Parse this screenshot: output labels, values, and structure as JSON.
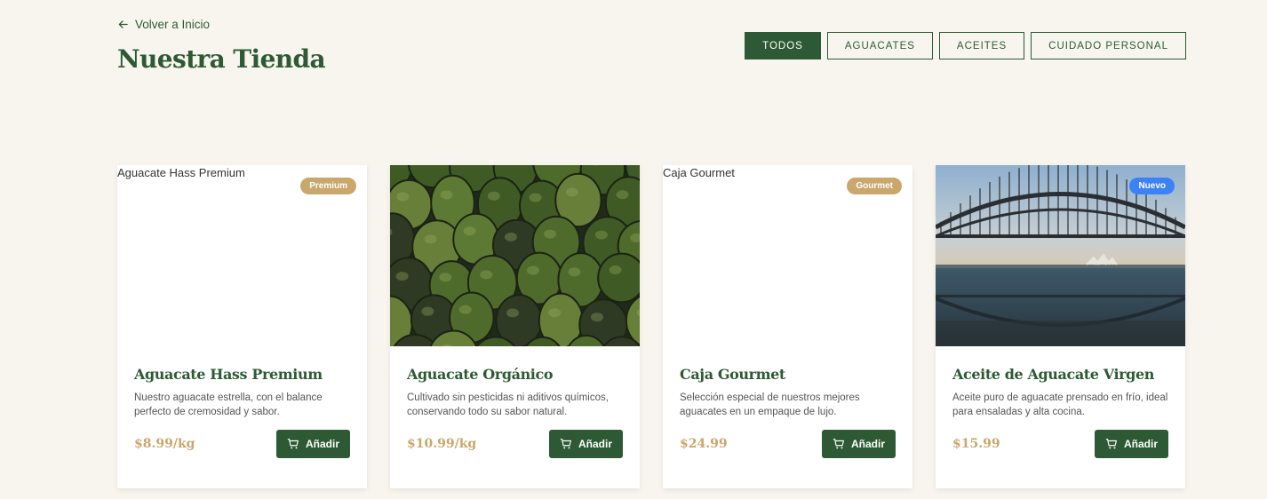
{
  "header": {
    "back_label": "Volver a Inicio",
    "title": "Nuestra Tienda"
  },
  "filters": [
    {
      "label": "TODOS",
      "active": true
    },
    {
      "label": "AGUACATES",
      "active": false
    },
    {
      "label": "ACEITES",
      "active": false
    },
    {
      "label": "CUIDADO PERSONAL",
      "active": false
    }
  ],
  "colors": {
    "primary": "#2d5a34",
    "accent_gold": "#c9a76d",
    "badge_blue": "#3b82f6",
    "background": "#f8f5ee"
  },
  "products": [
    {
      "name": "Aguacate Hass Premium",
      "image_alt": "Aguacate Hass Premium",
      "image": "broken",
      "badge": "Premium",
      "badge_color": "#c9a76d",
      "description": "Nuestro aguacate estrella, con el balance perfecto de cremosidad y sabor.",
      "price": "$8.99/kg",
      "button_label": "Añadir"
    },
    {
      "name": "Aguacate Orgánico",
      "image_alt": "Aguacate Orgánico",
      "image": "avocados-photo",
      "badge": "",
      "badge_color": "",
      "description": "Cultivado sin pesticidas ni aditivos químicos, conservando todo su sabor natural.",
      "price": "$10.99/kg",
      "button_label": "Añadir"
    },
    {
      "name": "Caja Gourmet",
      "image_alt": "Caja Gourmet",
      "image": "broken",
      "badge": "Gourmet",
      "badge_color": "#c9a76d",
      "description": "Selección especial de nuestros mejores aguacates en un empaque de lujo.",
      "price": "$24.99",
      "button_label": "Añadir"
    },
    {
      "name": "Aceite de Aguacate Virgen",
      "image_alt": "Aceite de Aguacate Virgen",
      "image": "bridge-photo",
      "badge": "Nuevo",
      "badge_color": "#3b82f6",
      "description": "Aceite puro de aguacate prensado en frío, ideal para ensaladas y alta cocina.",
      "price": "$15.99",
      "button_label": "Añadir"
    }
  ]
}
